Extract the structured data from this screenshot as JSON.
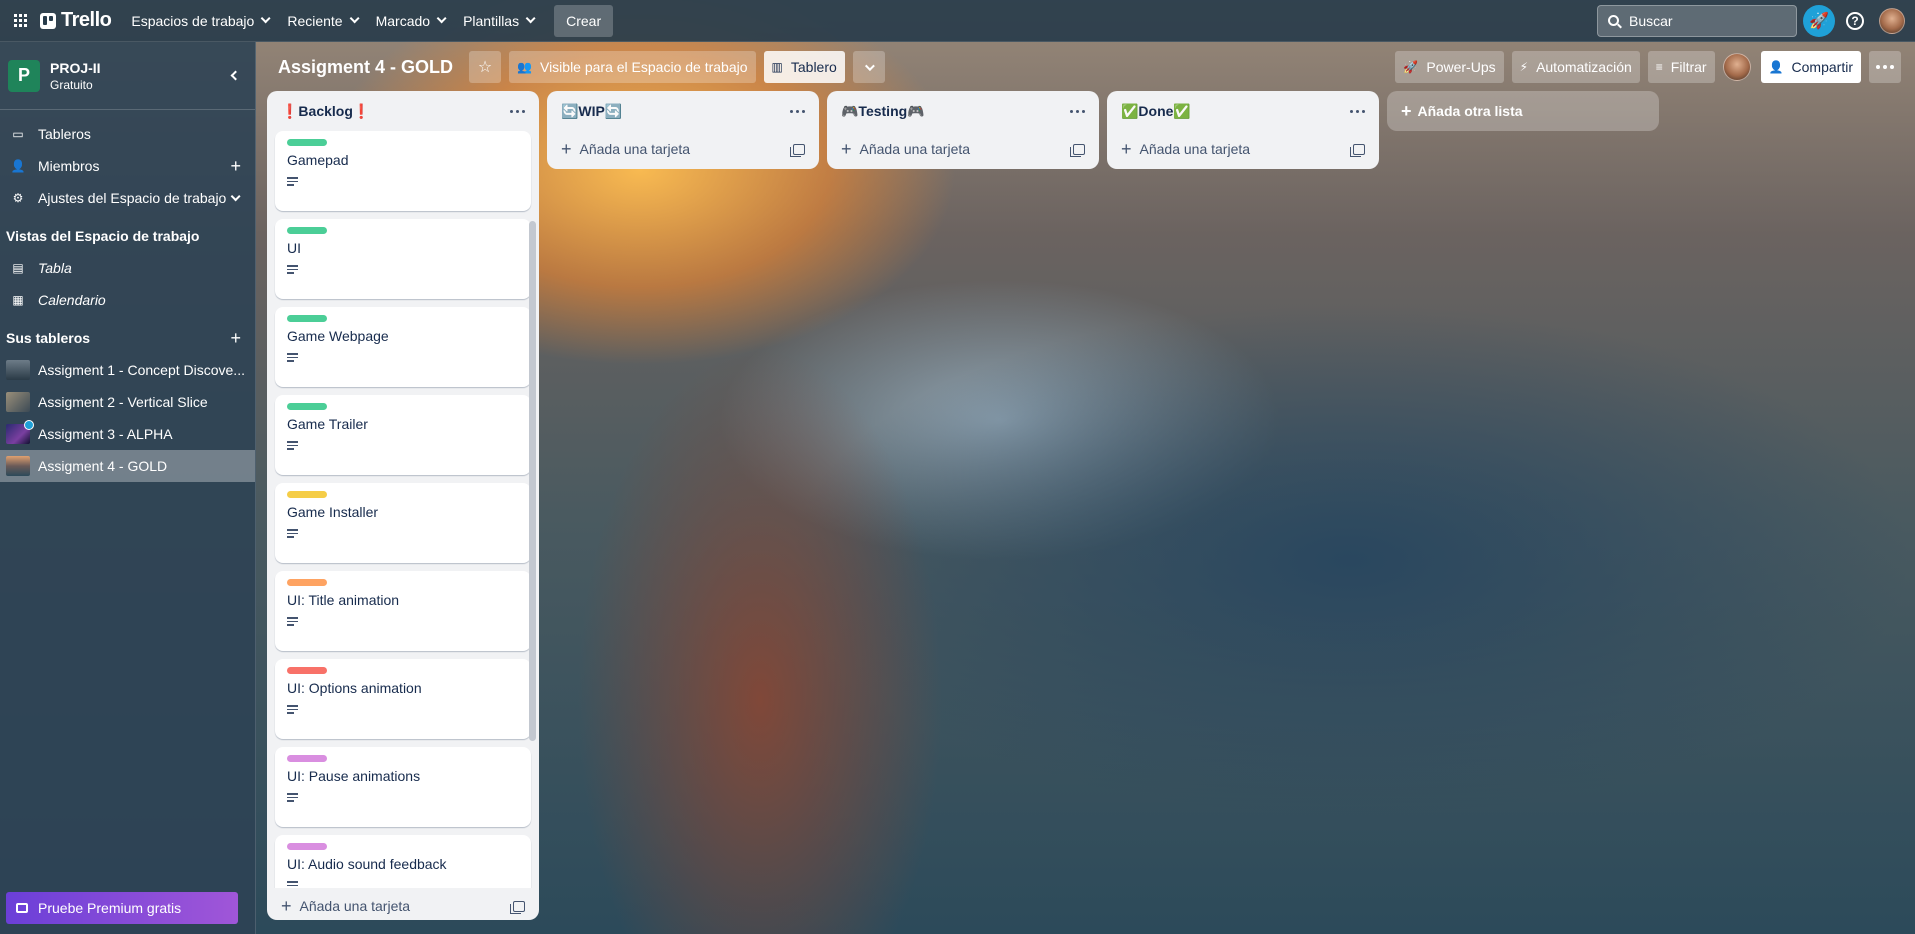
{
  "topnav": {
    "logo": "Trello",
    "menus": [
      "Espacios de trabajo",
      "Reciente",
      "Marcado",
      "Plantillas"
    ],
    "create_label": "Crear",
    "search_placeholder": "Buscar",
    "help_glyph": "?"
  },
  "sidebar": {
    "workspace": {
      "initial": "P",
      "name": "PROJ-II",
      "plan": "Gratuito",
      "color": "#1f845a"
    },
    "items": [
      {
        "label": "Tableros",
        "icon": "board-icon"
      },
      {
        "label": "Miembros",
        "icon": "members-icon"
      },
      {
        "label": "Ajustes del Espacio de trabajo",
        "icon": "settings-icon"
      }
    ],
    "views_title": "Vistas del Espacio de trabajo",
    "views": [
      {
        "label": "Tabla",
        "icon": "table-icon"
      },
      {
        "label": "Calendario",
        "icon": "calendar-icon"
      }
    ],
    "boards_title": "Sus tableros",
    "boards": [
      {
        "label": "Assigment 1 - Concept Discove..."
      },
      {
        "label": "Assigment 2 - Vertical Slice"
      },
      {
        "label": "Assigment 3 - ALPHA"
      },
      {
        "label": "Assigment 4 - GOLD",
        "active": true
      }
    ],
    "premium_label": "Pruebe Premium gratis"
  },
  "board_header": {
    "title": "Assigment 4 - GOLD",
    "visibility_label": "Visible para el Espacio de trabajo",
    "view_label": "Tablero",
    "powerups_label": "Power-Ups",
    "automation_label": "Automatización",
    "filter_label": "Filtrar",
    "share_label": "Compartir"
  },
  "lists": {
    "backlog": {
      "title": "❗Backlog❗",
      "cards": [
        {
          "title": "Gamepad",
          "label_color": "#4bce97"
        },
        {
          "title": "UI",
          "label_color": "#4bce97"
        },
        {
          "title": "Game Webpage",
          "label_color": "#4bce97"
        },
        {
          "title": "Game Trailer",
          "label_color": "#4bce97"
        },
        {
          "title": "Game Installer",
          "label_color": "#f5cd47"
        },
        {
          "title": "UI: Title animation",
          "label_color": "#fea362"
        },
        {
          "title": "UI: Options animation",
          "label_color": "#f87168"
        },
        {
          "title": "UI: Pause animations",
          "label_color": "#d98ee0"
        },
        {
          "title": "UI: Audio sound feedback",
          "label_color": "#d98ee0"
        }
      ],
      "add_card_label": "Añada una tarjeta"
    },
    "wip": {
      "title": "🔄WIP🔄",
      "add_card_label": "Añada una tarjeta"
    },
    "testing": {
      "title": "🎮Testing🎮",
      "add_card_label": "Añada una tarjeta"
    },
    "done": {
      "title": "✅Done✅",
      "add_card_label": "Añada una tarjeta"
    },
    "add_list_label": "Añada otra lista"
  }
}
